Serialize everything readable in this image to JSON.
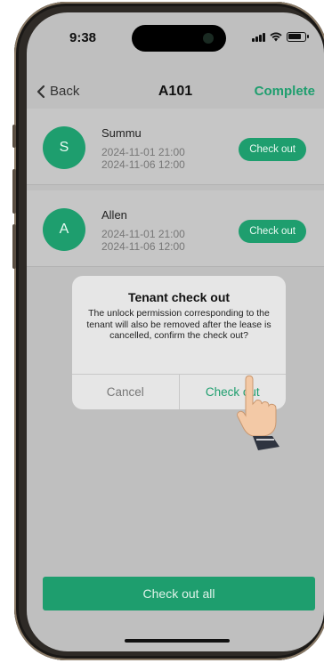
{
  "status_bar": {
    "time": "9:38"
  },
  "nav": {
    "back_label": "Back",
    "title": "A101",
    "complete_label": "Complete"
  },
  "tenants": [
    {
      "initial": "S",
      "name": "Summu",
      "start": "2024-11-01 21:00",
      "end": "2024-11-06 12:00",
      "action": "Check out"
    },
    {
      "initial": "A",
      "name": "Allen",
      "start": "2024-11-01 21:00",
      "end": "2024-11-06 12:00",
      "action": "Check out"
    }
  ],
  "dialog": {
    "title": "Tenant check out",
    "message": "The unlock permission corresponding to the tenant will also be removed after the lease is cancelled, confirm the check out?",
    "cancel_label": "Cancel",
    "confirm_label": "Check out"
  },
  "footer": {
    "check_out_all_label": "Check out all"
  },
  "colors": {
    "accent": "#1e9e6e",
    "overlay": "#bfbfbf"
  },
  "icons": {
    "back": "chevron-left-icon",
    "signal": "signal-icon",
    "wifi": "wifi-icon",
    "battery": "battery-icon",
    "pointer": "pointing-hand-icon"
  }
}
